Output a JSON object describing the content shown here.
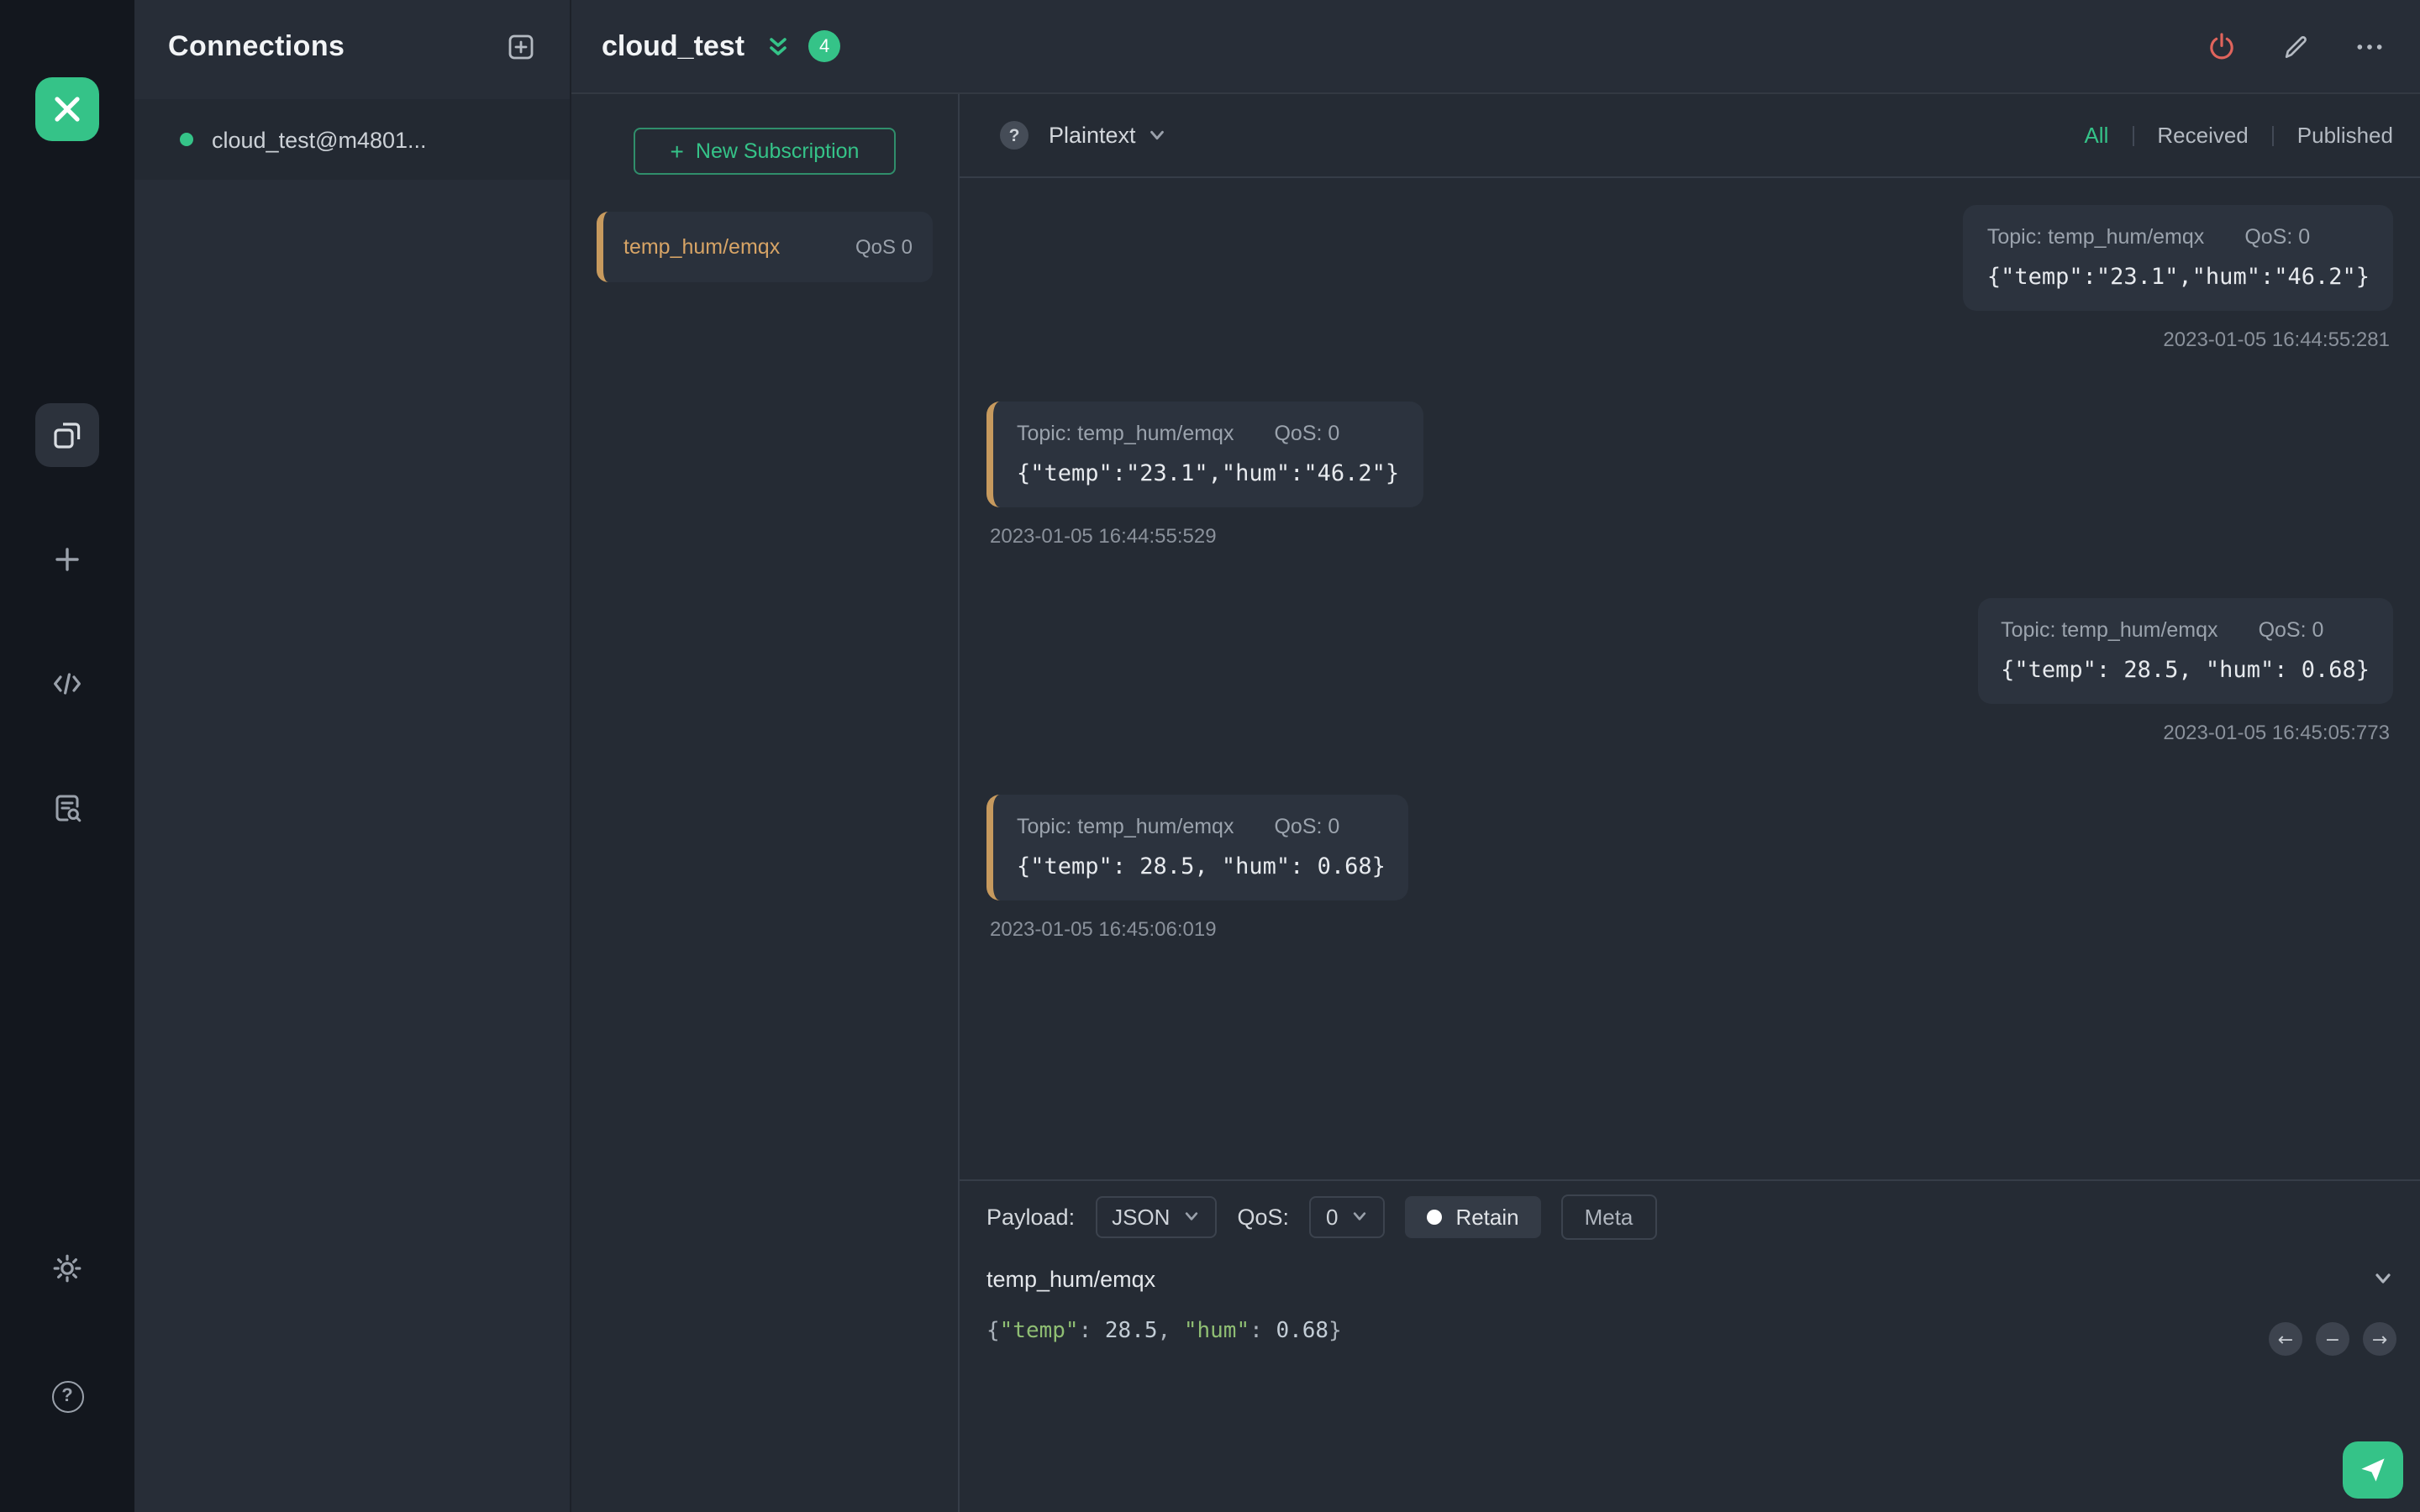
{
  "icons": {
    "help": "?",
    "plus": "+",
    "arrow_left": "←",
    "minus": "−",
    "arrow_right": "→"
  },
  "connections": {
    "title": "Connections",
    "items": [
      {
        "name": "cloud_test@m4801...",
        "status": "connected"
      }
    ]
  },
  "header": {
    "title": "cloud_test",
    "badge": "4"
  },
  "subscriptions": {
    "new_label": "New Subscription",
    "items": [
      {
        "topic": "temp_hum/emqx",
        "qos": "QoS 0"
      }
    ]
  },
  "msgbar": {
    "format": "Plaintext",
    "filters": [
      "All",
      "Received",
      "Published"
    ],
    "active_filter": "All"
  },
  "messages": [
    {
      "direction": "published",
      "topic": "Topic: temp_hum/emqx",
      "qos": "QoS: 0",
      "payload": "{\"temp\":\"23.1\",\"hum\":\"46.2\"}",
      "time": "2023-01-05 16:44:55:281"
    },
    {
      "direction": "received",
      "topic": "Topic: temp_hum/emqx",
      "qos": "QoS: 0",
      "payload": "{\"temp\":\"23.1\",\"hum\":\"46.2\"}",
      "time": "2023-01-05 16:44:55:529"
    },
    {
      "direction": "published",
      "topic": "Topic: temp_hum/emqx",
      "qos": "QoS: 0",
      "payload": "{\"temp\": 28.5, \"hum\": 0.68}",
      "time": "2023-01-05 16:45:05:773"
    },
    {
      "direction": "received",
      "topic": "Topic: temp_hum/emqx",
      "qos": "QoS: 0",
      "payload": "{\"temp\": 28.5, \"hum\": 0.68}",
      "time": "2023-01-05 16:45:06:019"
    }
  ],
  "publish": {
    "payload_label": "Payload:",
    "format_value": "JSON",
    "qos_label": "QoS:",
    "qos_value": "0",
    "retain_label": "Retain",
    "meta_label": "Meta",
    "topic_value": "temp_hum/emqx",
    "editor_text": "{\"temp\": 28.5, \"hum\": 0.68}",
    "editor_segments": [
      {
        "text": "{",
        "type": "punct"
      },
      {
        "text": "\"temp\"",
        "type": "key"
      },
      {
        "text": ": ",
        "type": "punct"
      },
      {
        "text": "28.5",
        "type": "number"
      },
      {
        "text": ", ",
        "type": "punct"
      },
      {
        "text": "\"hum\"",
        "type": "key"
      },
      {
        "text": ": ",
        "type": "punct"
      },
      {
        "text": "0.68",
        "type": "number"
      },
      {
        "text": "}",
        "type": "punct"
      }
    ]
  },
  "colors": {
    "accent_green": "#35c388",
    "subscription_orange": "#c79a5e",
    "disconnect_red": "#e0645c"
  }
}
